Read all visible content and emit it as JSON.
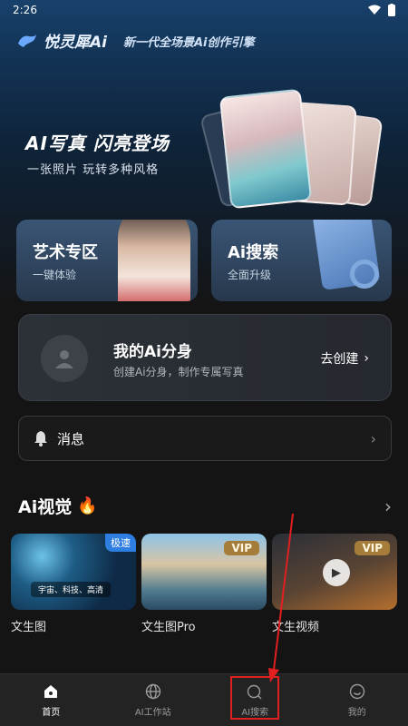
{
  "status_bar": {
    "time": "2:26"
  },
  "brand": {
    "logo": "悦灵犀Ai",
    "tagline": "新一代全场景Ai创作引擎"
  },
  "promo": {
    "title": "AI写真 闪亮登场",
    "subtitle": "一张照片 玩转多种风格"
  },
  "features": [
    {
      "title": "艺术专区",
      "subtitle": "一键体验"
    },
    {
      "title": "Ai搜索",
      "subtitle": "全面升级"
    }
  ],
  "clone_card": {
    "title": "我的Ai分身",
    "subtitle": "创建Ai分身，制作专属写真",
    "action": "去创建"
  },
  "messages": {
    "label": "消息"
  },
  "ai_visual": {
    "title": "Ai视觉",
    "tiles": [
      {
        "label": "文生图",
        "badge": "极速",
        "caption": "宇宙、科技、高清"
      },
      {
        "label": "文生图Pro",
        "badge": "VIP"
      },
      {
        "label": "文生视频",
        "badge": "VIP"
      }
    ]
  },
  "bottom_nav": [
    {
      "label": "首页",
      "icon": "home-icon",
      "active": true
    },
    {
      "label": "AI工作站",
      "icon": "globe-icon",
      "active": false
    },
    {
      "label": "AI搜索",
      "icon": "ai-search-icon",
      "active": false
    },
    {
      "label": "我的",
      "icon": "smile-icon",
      "active": false
    }
  ],
  "colors": {
    "accent_blue": "#2e7de0",
    "vip_gold": "#a67c3a",
    "highlight_red": "#e02020"
  }
}
